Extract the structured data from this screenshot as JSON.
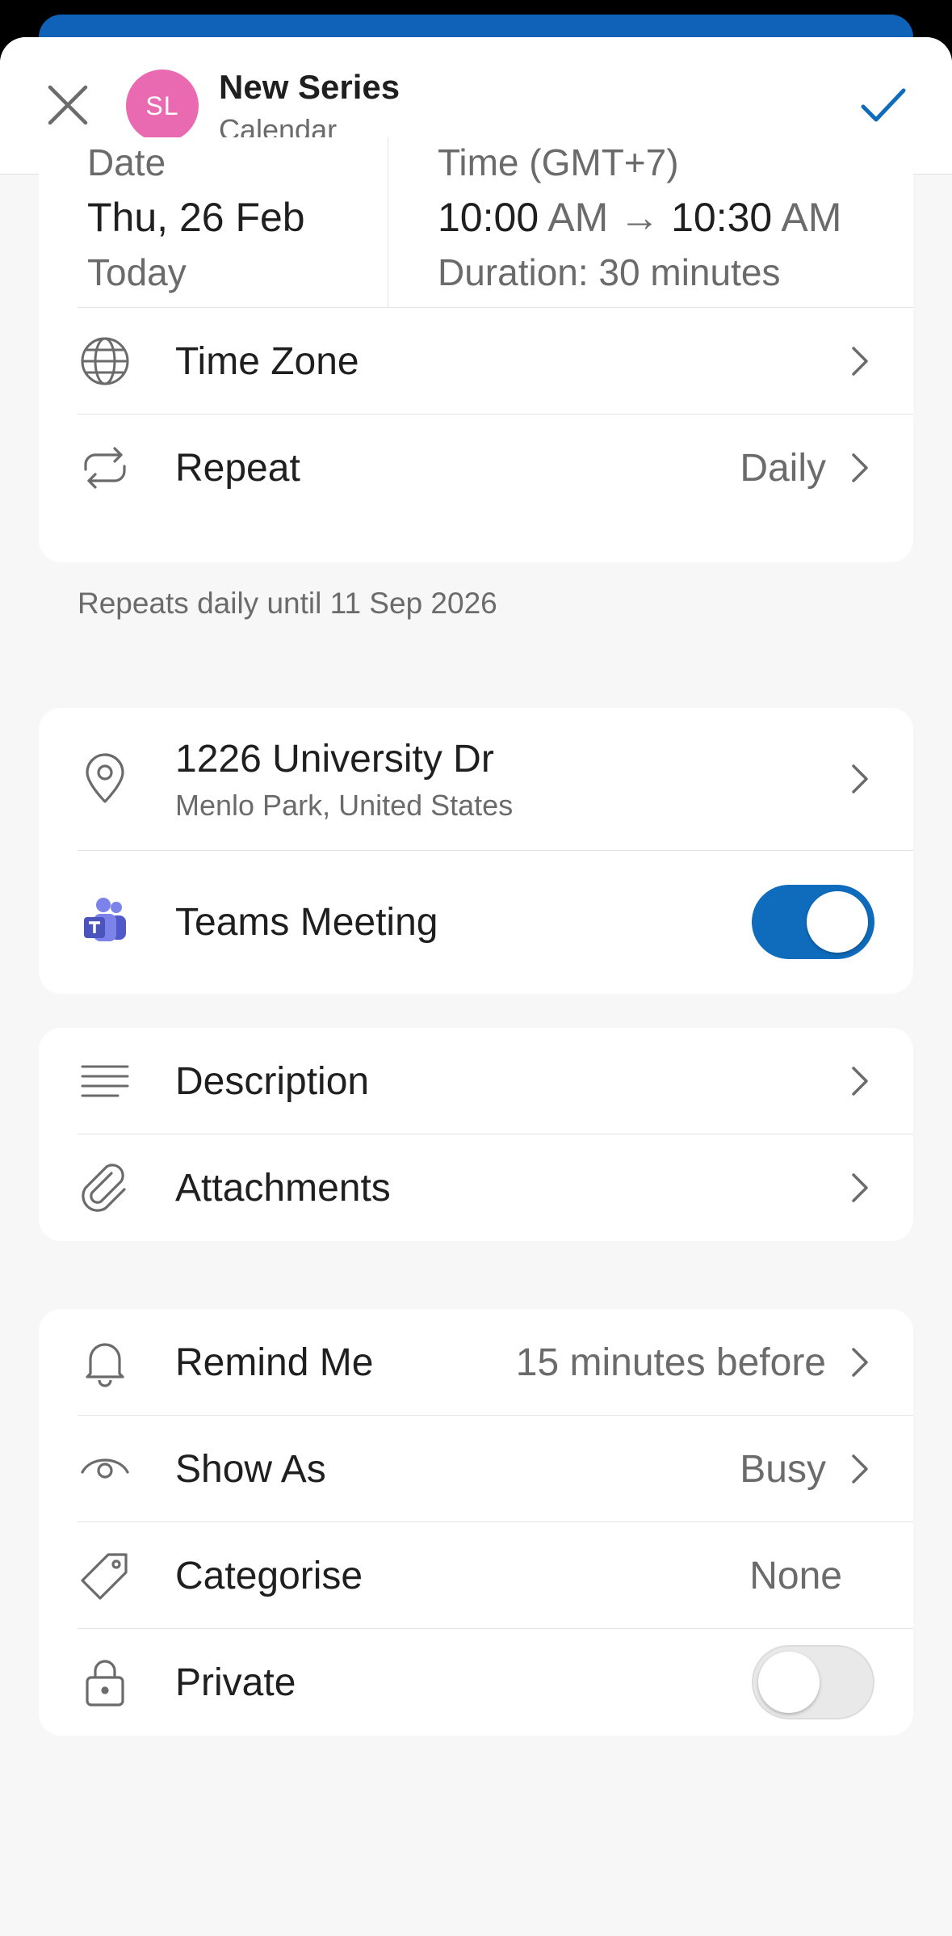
{
  "header": {
    "avatar_initials": "SL",
    "title": "New Series",
    "subtitle": "Calendar"
  },
  "datetime": {
    "date_label": "Date",
    "date_value": "Thu, 26 Feb",
    "date_sub": "Today",
    "time_label": "Time (GMT+7)",
    "start_time": "10:00",
    "start_ampm": "AM",
    "arrow": "→",
    "end_time": "10:30",
    "end_ampm": "AM",
    "duration": "Duration: 30 minutes"
  },
  "time_zone": {
    "label": "Time Zone"
  },
  "repeat": {
    "label": "Repeat",
    "value": "Daily"
  },
  "repeat_note": "Repeats daily until 11 Sep 2026",
  "location": {
    "title": "1226 University Dr",
    "subtitle": "Menlo Park, United States"
  },
  "teams": {
    "label": "Teams Meeting",
    "enabled": true
  },
  "description": {
    "label": "Description"
  },
  "attachments": {
    "label": "Attachments"
  },
  "remind": {
    "label": "Remind Me",
    "value": "15 minutes before"
  },
  "show_as": {
    "label": "Show As",
    "value": "Busy"
  },
  "categorise": {
    "label": "Categorise",
    "value": "None"
  },
  "private": {
    "label": "Private",
    "enabled": false
  },
  "colors": {
    "accent": "#0f6cbd",
    "avatar": "#ea6ab2",
    "teams": "#5b5fc7"
  }
}
